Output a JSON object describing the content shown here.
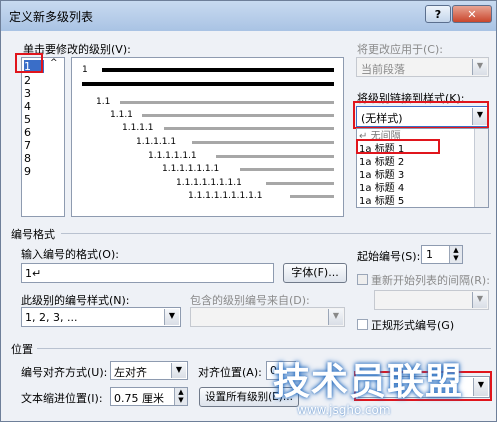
{
  "window": {
    "title": "定义新多级列表",
    "help": "?",
    "close": "✕"
  },
  "level_section": {
    "label": "单击要修改的级别(V):",
    "levels": [
      "1",
      "2",
      "3",
      "4",
      "5",
      "6",
      "7",
      "8",
      "9"
    ]
  },
  "preview": {
    "lines": [
      "1",
      "1.1",
      "1.1.1",
      "1.1.1.1",
      "1.1.1.1.1",
      "1.1.1.1.1.1",
      "1.1.1.1.1.1.1",
      "1.1.1.1.1.1.1.1",
      "1.1.1.1.1.1.1.1.1"
    ]
  },
  "apply_to": {
    "label": "将更改应用于(C):",
    "value": "当前段落"
  },
  "link_style": {
    "label": "将级别链接到样式(K):",
    "value": "(无样式)",
    "options": [
      {
        "icon": "↵",
        "label": "无间隔"
      },
      {
        "icon": "1a",
        "label": "标题 1"
      },
      {
        "icon": "1a",
        "label": "标题 2"
      },
      {
        "icon": "1a",
        "label": "标题 3"
      },
      {
        "icon": "1a",
        "label": "标题 4"
      },
      {
        "icon": "1a",
        "label": "标题 5"
      }
    ]
  },
  "number_format": {
    "group_label": "编号格式",
    "format_label": "输入编号的格式(O):",
    "format_value": "1↵",
    "font_button": "字体(F)...",
    "start_label": "起始编号(S):",
    "start_value": "1",
    "restart_label": "重新开始列表的间隔(R):",
    "style_label": "此级别的编号样式(N):",
    "style_value": "1, 2, 3, ...",
    "include_label": "包含的级别编号来自(D):",
    "legal_label": "正规形式编号(G)"
  },
  "position": {
    "group_label": "位置",
    "align_label": "编号对齐方式(U):",
    "align_value": "左对齐",
    "align_at_label": "对齐位置(A):",
    "align_at_value": "0",
    "indent_label": "文本缩进位置(I):",
    "indent_value": "0.75 厘米",
    "set_all_button": "设置所有级别(E)..."
  },
  "watermark": {
    "text": "技术员联盟",
    "url": "www.jsgho.com"
  }
}
